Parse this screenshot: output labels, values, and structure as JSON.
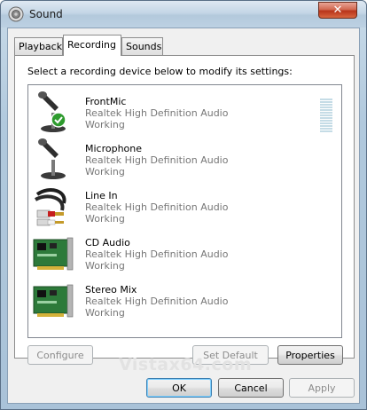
{
  "window": {
    "title": "Sound",
    "close_label": "✕"
  },
  "tabs": [
    {
      "label": "Playback",
      "active": false
    },
    {
      "label": "Recording",
      "active": true
    },
    {
      "label": "Sounds",
      "active": false
    }
  ],
  "instruction": "Select a recording device below to modify its settings:",
  "devices": [
    {
      "name": "FrontMic",
      "description": "Realtek High Definition Audio",
      "status": "Working",
      "icon": "microphone-default-icon"
    },
    {
      "name": "Microphone",
      "description": "Realtek High Definition Audio",
      "status": "Working",
      "icon": "microphone-icon"
    },
    {
      "name": "Line In",
      "description": "Realtek High Definition Audio",
      "status": "Working",
      "icon": "rca-cable-icon"
    },
    {
      "name": "CD Audio",
      "description": "Realtek High Definition Audio",
      "status": "Working",
      "icon": "sound-card-icon"
    },
    {
      "name": "Stereo Mix",
      "description": "Realtek High Definition Audio",
      "status": "Working",
      "icon": "sound-card-icon"
    }
  ],
  "buttons": {
    "configure": "Configure",
    "set_default": "Set Default",
    "properties": "Properties",
    "ok": "OK",
    "cancel": "Cancel",
    "apply": "Apply"
  },
  "watermark": "Vistax64.com",
  "colors": {
    "accent": "#3c7fb1",
    "close": "#c8452a",
    "default_check": "#2e9b2e"
  }
}
